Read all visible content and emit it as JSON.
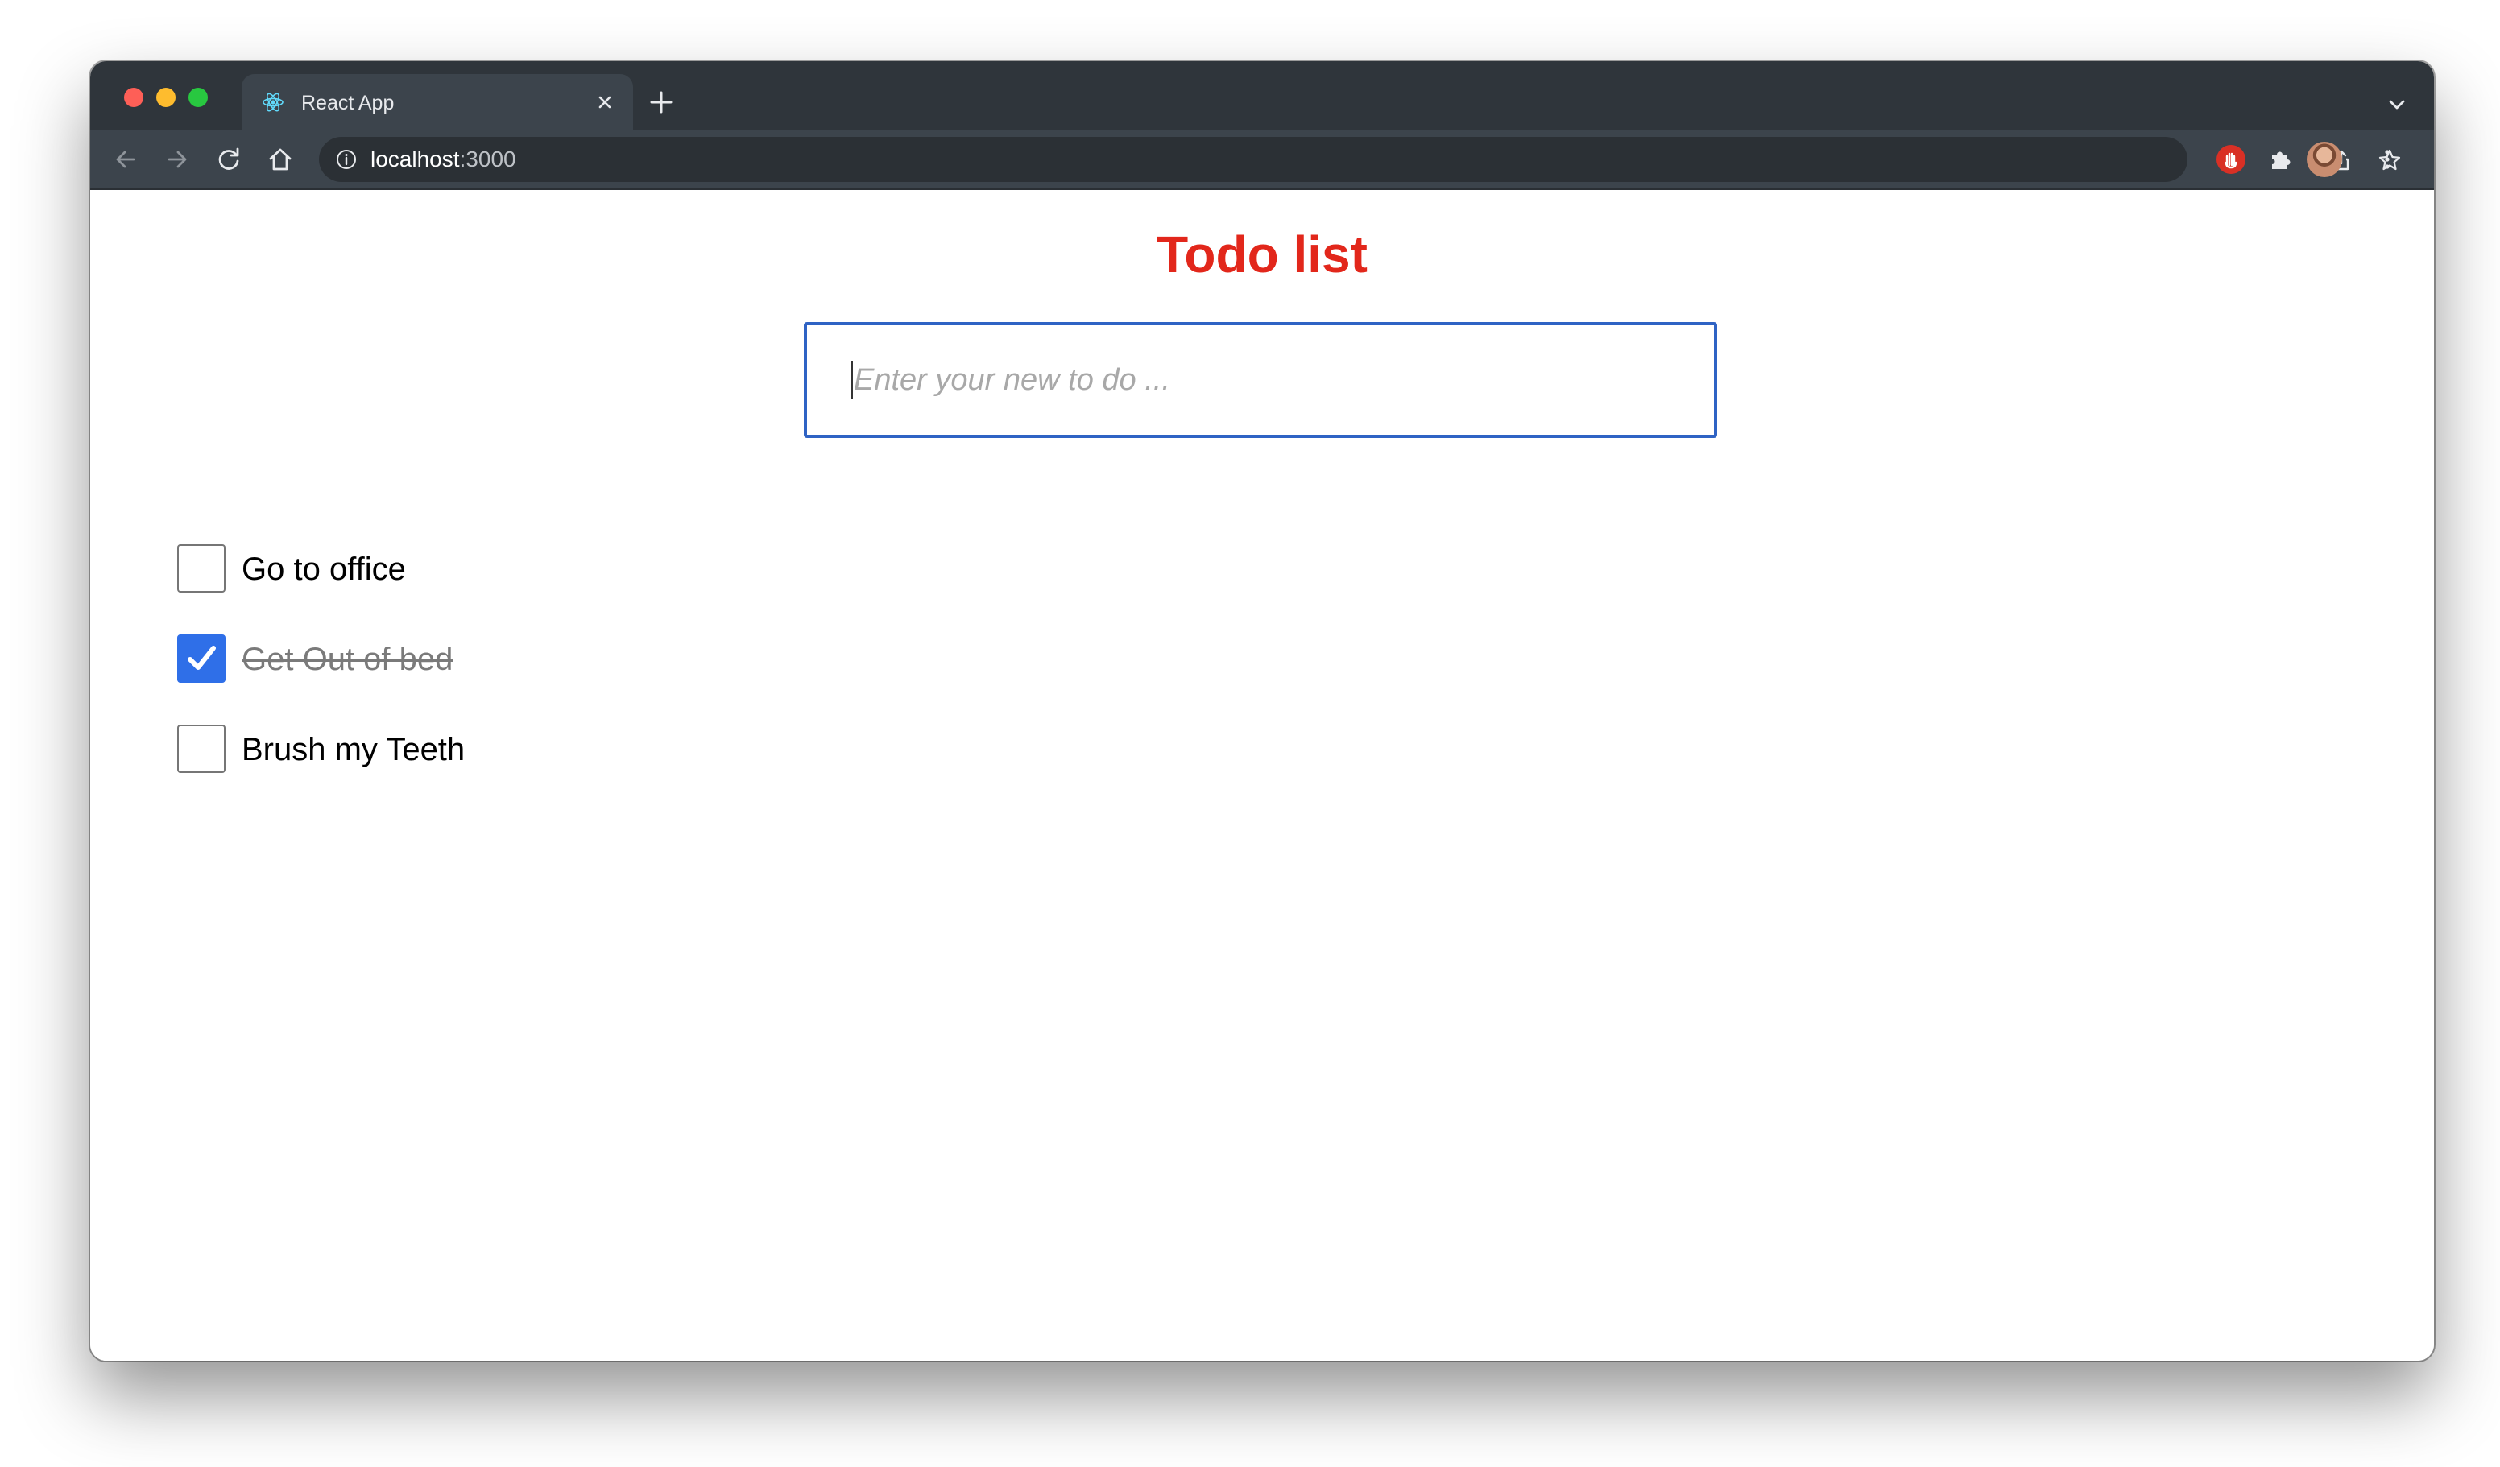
{
  "browser": {
    "tab_title": "React App",
    "favicon": "react-logo-icon",
    "url_host": "localhost",
    "url_port": ":3000",
    "icons": {
      "back": "back-arrow-icon",
      "forward": "forward-arrow-icon",
      "reload": "reload-icon",
      "home": "home-icon",
      "info": "info-icon",
      "share": "share-icon",
      "bookmark": "star-icon",
      "extension": "extension-puzzle-icon",
      "menu": "kebab-menu-icon"
    }
  },
  "page": {
    "title": "Todo list",
    "title_color": "#e2271b",
    "input": {
      "placeholder": "Enter your new to do ...",
      "value": ""
    },
    "todos": [
      {
        "text": "Go to office",
        "completed": false
      },
      {
        "text": "Get Out of bed",
        "completed": true
      },
      {
        "text": "Brush my Teeth",
        "completed": false
      }
    ]
  }
}
